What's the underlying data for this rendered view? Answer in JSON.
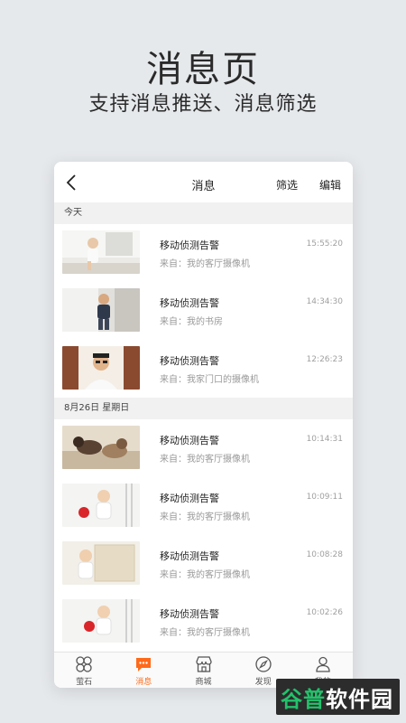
{
  "promo": {
    "title": "消息页",
    "subtitle": "支持消息推送、消息筛选"
  },
  "nav": {
    "back_icon": "chevron-left-icon",
    "title": "消息",
    "filter_label": "筛选",
    "edit_label": "编辑"
  },
  "sections": [
    {
      "header": "今天",
      "items": [
        {
          "title": "移动侦测告警",
          "source": "来自：我的客厅摄像机",
          "time": "15:55:20",
          "thumb": "baby-at-window"
        },
        {
          "title": "移动侦测告警",
          "source": "来自：我的书房",
          "time": "14:34:30",
          "thumb": "toddler-at-curtain"
        },
        {
          "title": "移动侦测告警",
          "source": "来自：我家门口的摄像机",
          "time": "12:26:23",
          "thumb": "man-smiling"
        }
      ]
    },
    {
      "header": "8月26日  星期日",
      "items": [
        {
          "title": "移动侦测告警",
          "source": "来自：我的客厅摄像机",
          "time": "10:14:31",
          "thumb": "dogs-on-sofa"
        },
        {
          "title": "移动侦测告警",
          "source": "来自：我的客厅摄像机",
          "time": "10:09:11",
          "thumb": "baby-with-ball"
        },
        {
          "title": "移动侦测告警",
          "source": "来自：我的客厅摄像机",
          "time": "10:08:28",
          "thumb": "baby-at-door"
        },
        {
          "title": "移动侦测告警",
          "source": "来自：我的客厅摄像机",
          "time": "10:02:26",
          "thumb": "baby-with-ball"
        }
      ]
    }
  ],
  "tabbar": [
    {
      "label": "萤石",
      "icon": "clover-icon",
      "active": false
    },
    {
      "label": "消息",
      "icon": "chat-bubble-icon",
      "active": true
    },
    {
      "label": "商城",
      "icon": "store-icon",
      "active": false
    },
    {
      "label": "发现",
      "icon": "compass-icon",
      "active": false
    },
    {
      "label": "我的",
      "icon": "person-icon",
      "active": false
    }
  ],
  "watermark": {
    "part1": "谷普",
    "part2": "软件园"
  },
  "colors": {
    "accent": "#ff6a1a",
    "watermark_green": "#23c16b",
    "background": "#e6e9ec"
  }
}
